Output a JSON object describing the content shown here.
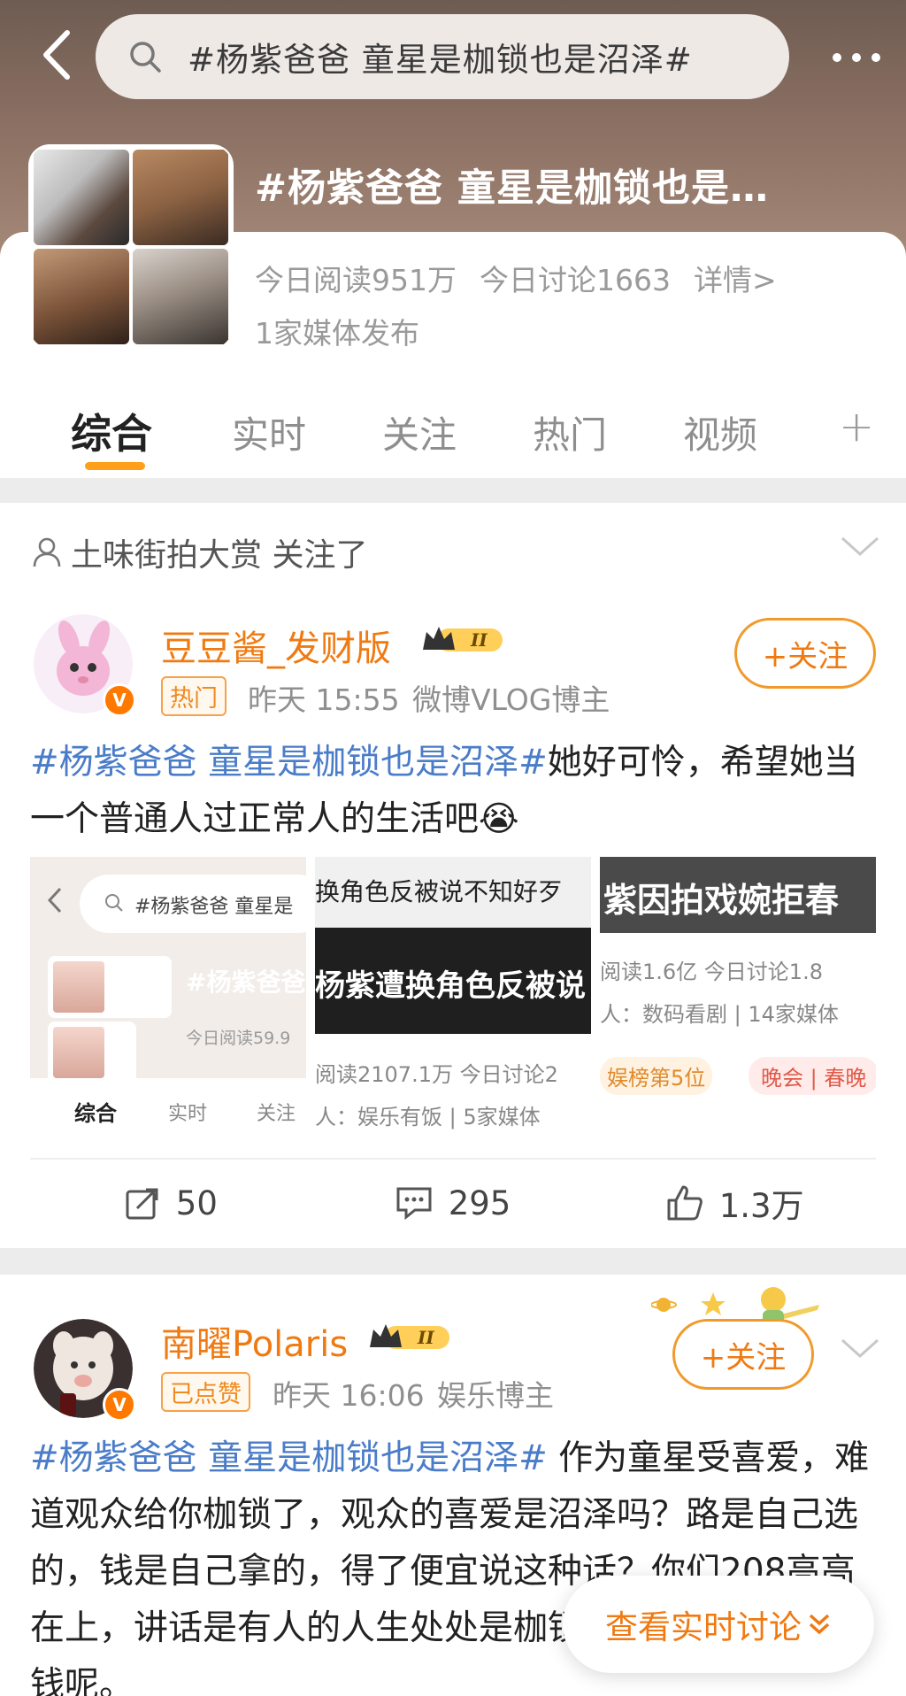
{
  "search": {
    "query": "#杨紫爸爸 童星是枷锁也是沼泽#"
  },
  "topic": {
    "title": "#杨紫爸爸 童星是枷锁也是…",
    "read_today": "今日阅读951万",
    "discuss_today": "今日讨论1663",
    "details": "详情>",
    "media": "1家媒体发布"
  },
  "tabs": [
    {
      "label": "综合",
      "active": true
    },
    {
      "label": "实时"
    },
    {
      "label": "关注"
    },
    {
      "label": "热门"
    },
    {
      "label": "视频"
    }
  ],
  "tab_plus": "+",
  "posts": [
    {
      "follow_note": "土味街拍大赏 关注了",
      "username": "豆豆酱_发财版",
      "rank": "II",
      "tag": "热门",
      "time": "昨天 15:55",
      "source": "微博VLOG博主",
      "follow_label": "+关注",
      "hashtag": "#杨紫爸爸 童星是枷锁也是沼泽#",
      "text": "她好可怜，希望她当一个普通人过正常人的生活吧😭",
      "image_a": {
        "search": "#杨紫爸爸 童星是",
        "title": "#杨紫爸爸 童",
        "read": "今日阅读59.9",
        "tabs": [
          "综合",
          "实时",
          "关注"
        ]
      },
      "image_b": {
        "top": "换角色反被说不知好歹",
        "mid": "杨紫遭换角色反被说",
        "read": "阅读2107.1万  今日讨论2",
        "who": "人：娱乐有饭 | 5家媒体"
      },
      "image_c": {
        "top": "紫因拍戏婉拒春",
        "read": "阅读1.6亿  今日讨论1.8",
        "who": "人：数码看剧 | 14家媒体",
        "rank": "娱榜第5位",
        "tag": "晚会 | 春晚"
      },
      "reposts": "50",
      "comments": "295",
      "likes": "1.3万"
    },
    {
      "username": "南曜Polaris",
      "rank": "II",
      "tag": "已点赞",
      "time": "昨天 16:06",
      "source": "娱乐博主",
      "follow_label": "+关注",
      "hashtag": "#杨紫爸爸 童星是枷锁也是沼泽#",
      "text": " 作为童星受喜爱，难道观众给你枷锁了，观众的喜爱是沼泽吗？路是自己选的，钱是自己拿的，得了便宜说这种话？你们208高高在上，讲话是有人的人生处处是枷锁是沼泽，还赚不到钱呢。"
    }
  ],
  "realtime_button": "查看实时讨论",
  "colors": {
    "accent": "#f07a12",
    "hashtag": "#4a7cc8",
    "tab_underline": "#ff9f1a"
  }
}
